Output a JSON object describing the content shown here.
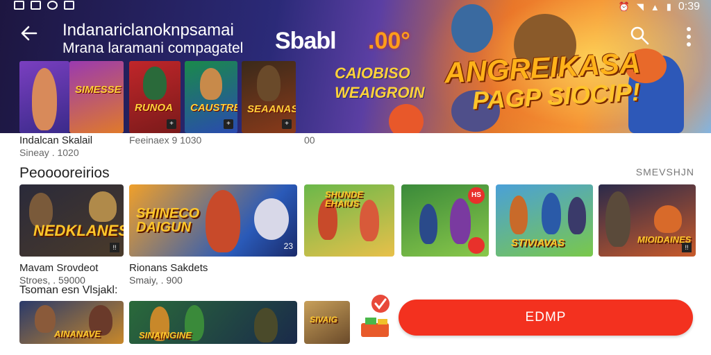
{
  "status_bar": {
    "time": "0:39",
    "icons": [
      "photo-icon",
      "image-icon",
      "globe-icon",
      "app-icon",
      "alarm-icon",
      "wifi-icon",
      "signal-icon",
      "battery-icon"
    ]
  },
  "header": {
    "title": "Indanariclanoknpsamai",
    "subtitle": "Mrana laramani compagatel",
    "brand": "Sbabl",
    "brand_badge": ".00°",
    "back_icon": "arrow-left-icon",
    "search_icon": "search-icon",
    "more_icon": "more-vertical-icon"
  },
  "hero": {
    "promo_left_line1": "CAIOBISO",
    "promo_left_line2": "WEAIGROIN",
    "promo_big": "ANGREIKASA",
    "promo_small": "PAGP SIOCIP!"
  },
  "top_strip": {
    "thumbs": [
      {
        "art": "",
        "badge": ""
      },
      {
        "art": "SIMESSE",
        "badge": ""
      },
      {
        "art": "RUNOA",
        "badge": "+"
      },
      {
        "art": "CAUSTRE",
        "badge": "+"
      },
      {
        "art": "SEAANAS",
        "badge": "+"
      }
    ],
    "captions": [
      {
        "title": "Indalcan Skalail",
        "sub": "Sineay . 1020"
      },
      {
        "title": "Feeinaex 9 1030",
        "sub": ""
      },
      {
        "title": "00",
        "sub": ""
      }
    ]
  },
  "section": {
    "title": "Peooooreirios",
    "see_all": "SMEVSHJN",
    "cards": [
      {
        "art": "NEDKLANES",
        "title": "Mavam Srovdeot",
        "sub": "Stroes, . 59000",
        "badge": "!!"
      },
      {
        "art": "SHINECO DAIGUN",
        "title": "Rionans Sakdets",
        "sub": "Smaiy, . 900",
        "badge": "23"
      },
      {
        "art": "SHUNDE EHAIUS",
        "title": "",
        "sub": "",
        "badge": ""
      },
      {
        "art": "",
        "title": "",
        "sub": "",
        "badge": "HS"
      },
      {
        "art": "STIVIAVAS",
        "title": "",
        "sub": "",
        "badge": ""
      },
      {
        "art": "MIOIDAINES",
        "title": "",
        "sub": "",
        "badge": "!!"
      }
    ]
  },
  "section2": {
    "title": "Tsoman esn Vlsjakl:",
    "cards": [
      {
        "art": "AINANAVE"
      },
      {
        "art": "SINAINGINE"
      },
      {
        "art": "SIVAIG"
      }
    ]
  },
  "action": {
    "install_label": "EDMP",
    "accent": "#f3311f"
  }
}
